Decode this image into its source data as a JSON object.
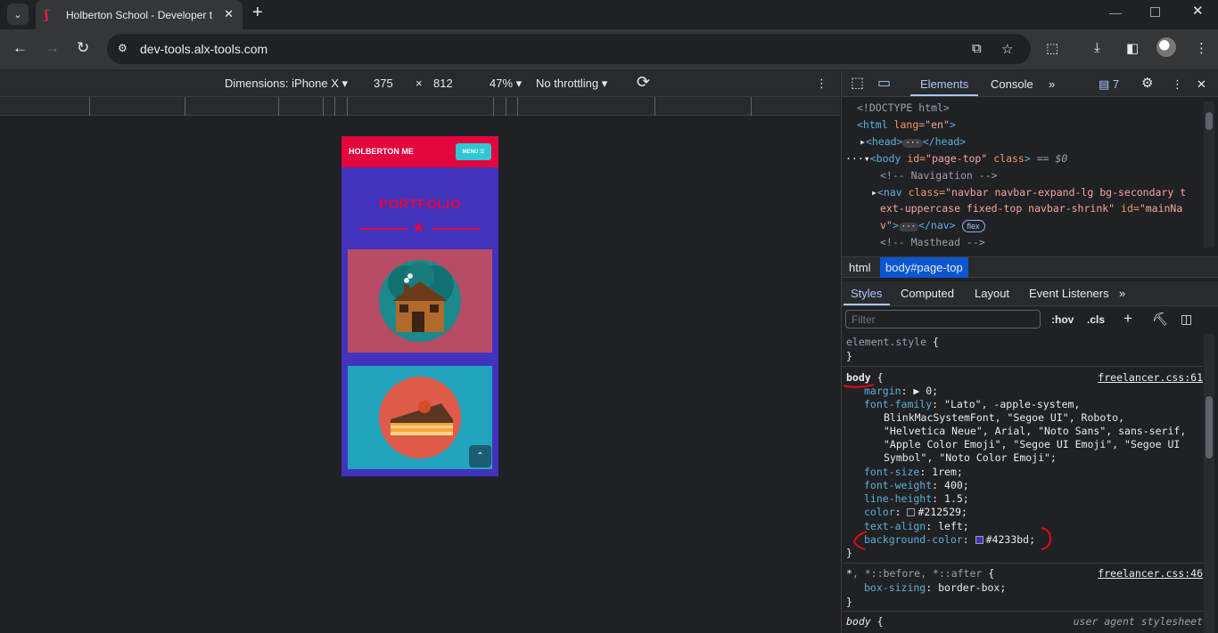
{
  "browser": {
    "tab_title": "Holberton School - Developer t",
    "tab_close": "✕",
    "new_tab": "+",
    "url": "dev-tools.alx-tools.com"
  },
  "device_toolbar": {
    "dimensions_label": "Dimensions: iPhone X",
    "width": "375",
    "times": "×",
    "height": "812",
    "zoom": "47%",
    "throttling": "No throttling"
  },
  "phone": {
    "brand": "HOLBERTON ME",
    "menu_label": "MENU ☰",
    "section_title": "PORTFOLIO",
    "colors": {
      "background": "#4233bd",
      "navbar": "#e3063d",
      "menu_button": "#2fc7d3",
      "card_1": "#b84c64",
      "card_2": "#22a4be"
    }
  },
  "devtools": {
    "tabs": [
      "Elements",
      "Console"
    ],
    "issues_count": "7",
    "dom": {
      "doctype": "<!DOCTYPE html>",
      "html_open_tag": "<html ",
      "html_lang_attr": "lang=",
      "html_lang_value": "\"en\"",
      "html_close_bracket": ">",
      "head_open": "<head>",
      "head_close": "</head>",
      "body_prefix": "···",
      "body_open": "<body ",
      "body_id_attr": "id=",
      "body_id_value": "\"page-top\"",
      "body_class_attr": " class",
      "body_gt": ">",
      "body_suffix": " == $0",
      "comment_nav": "<!-- Navigation -->",
      "nav_open": "<nav ",
      "nav_class_attr": "class=",
      "nav_class_value_1": "\"navbar navbar-expand-lg bg-secondary t",
      "nav_class_value_2": "ext-uppercase fixed-top navbar-shrink\"",
      "nav_id_attr": " id=",
      "nav_id_value_1": "\"mainNa",
      "nav_id_value_2": "v\"",
      "nav_gt": ">",
      "nav_close": "</nav>",
      "flex_badge": "flex",
      "comment_masthead": "<!-- Masthead -->"
    },
    "breadcrumbs": [
      "html",
      "body#page-top"
    ],
    "sub_tabs": [
      "Styles",
      "Computed",
      "Layout",
      "Event Listeners"
    ],
    "filter_placeholder": "Filter",
    "hov": ":hov",
    "cls": ".cls",
    "styles": {
      "element_style": "element.style",
      "open_brace": " {",
      "close_brace": "}",
      "body_selector": "body",
      "body_source": "freelancer.css:61",
      "body_props": [
        {
          "name": "margin",
          "value": "▶ 0;"
        },
        {
          "name": "font-family",
          "value": "\"Lato\", -apple-system,"
        },
        {
          "name": "",
          "value": "BlinkMacSystemFont, \"Segoe UI\", Roboto,"
        },
        {
          "name": "",
          "value": "\"Helvetica Neue\", Arial, \"Noto Sans\", sans-serif,"
        },
        {
          "name": "",
          "value": "\"Apple Color Emoji\", \"Segoe UI Emoji\", \"Segoe UI"
        },
        {
          "name": "",
          "value": "Symbol\", \"Noto Color Emoji\";"
        },
        {
          "name": "font-size",
          "value": "1rem;"
        },
        {
          "name": "font-weight",
          "value": "400;"
        },
        {
          "name": "line-height",
          "value": "1.5;"
        },
        {
          "name": "color",
          "value": "#212529;"
        },
        {
          "name": "text-align",
          "value": "left;"
        },
        {
          "name": "background-color",
          "value": "#4233bd;"
        }
      ],
      "color_swatch": "#212529",
      "bg_swatch": "#4233bd",
      "universal_selector_main": "*",
      "universal_selector_rest": ", *::before, *::after",
      "universal_source": "freelancer.css:46",
      "box_sizing_name": "box-sizing",
      "box_sizing_value": "border-box;",
      "body_ua_selector": "body",
      "ua_source": "user agent stylesheet"
    }
  }
}
